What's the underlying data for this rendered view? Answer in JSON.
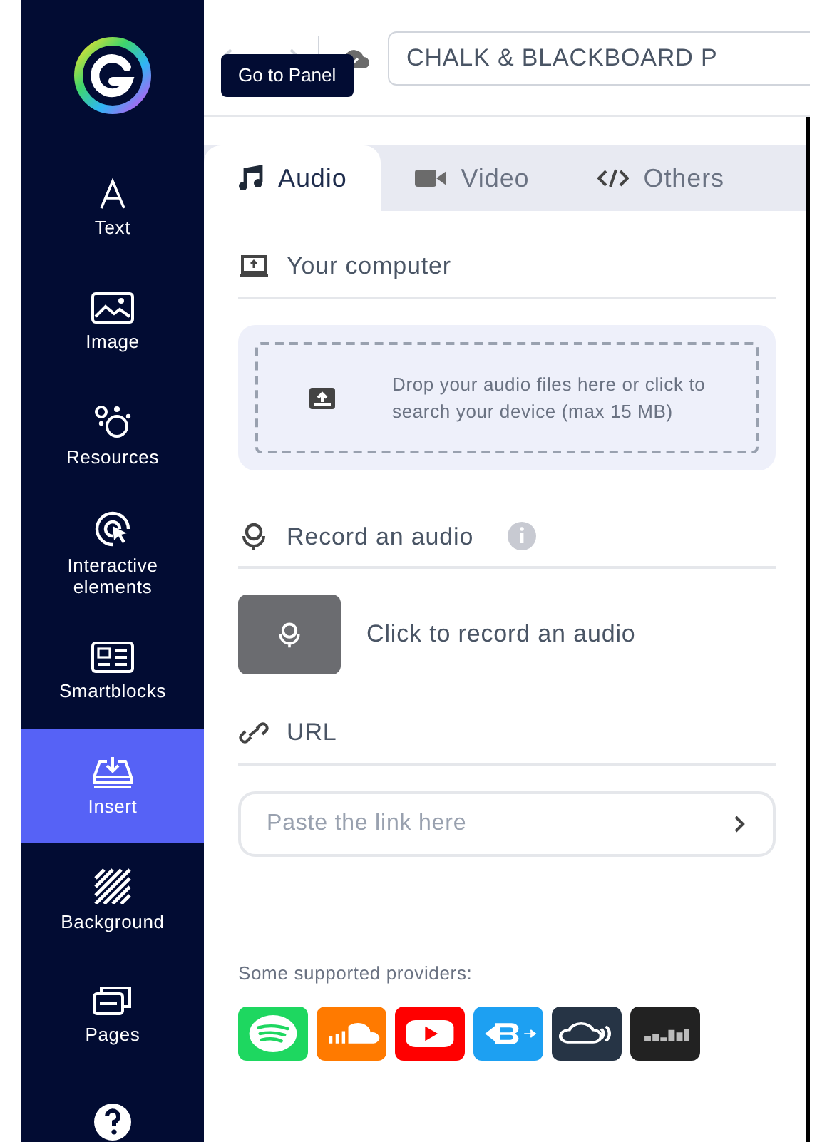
{
  "sidebar": {
    "items": [
      {
        "label": "Text",
        "selected": false
      },
      {
        "label": "Image",
        "selected": false
      },
      {
        "label": "Resources",
        "selected": false
      },
      {
        "label": "Interactive elements",
        "selected": false
      },
      {
        "label": "Smartblocks",
        "selected": false
      },
      {
        "label": "Insert",
        "selected": true
      },
      {
        "label": "Background",
        "selected": false
      },
      {
        "label": "Pages",
        "selected": false
      }
    ]
  },
  "toolbar": {
    "title_value": "CHALK & BLACKBOARD P",
    "tooltip": "Go to Panel"
  },
  "tabs": [
    {
      "label": "Audio",
      "selected": true
    },
    {
      "label": "Video",
      "selected": false
    },
    {
      "label": "Others",
      "selected": false
    }
  ],
  "computer": {
    "heading": "Your computer",
    "dropzone_text": "Drop your audio files here or click to search your device (max 15 MB)"
  },
  "record": {
    "heading": "Record an audio",
    "button_label": "Click to record an audio"
  },
  "url": {
    "heading": "URL",
    "placeholder": "Paste the link here"
  },
  "providers": {
    "label": "Some supported providers:",
    "items": [
      {
        "color": "#1ed760"
      },
      {
        "color": "#ff7a00"
      },
      {
        "color": "#ff0000"
      },
      {
        "color": "#1da0f2"
      },
      {
        "color": "#263445"
      },
      {
        "color": "#222222"
      }
    ]
  }
}
